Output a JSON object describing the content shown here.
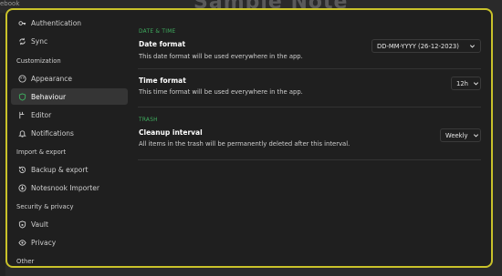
{
  "backdrop": {
    "breadcrumb": "ebook",
    "note_title": "Sample Note"
  },
  "sidebar": {
    "items": [
      {
        "label": "Authentication",
        "icon": "key-icon"
      },
      {
        "label": "Sync",
        "icon": "sync-icon"
      },
      {
        "label": "Appearance",
        "icon": "palette-icon"
      },
      {
        "label": "Behaviour",
        "icon": "shield-icon",
        "active": true
      },
      {
        "label": "Editor",
        "icon": "editor-icon"
      },
      {
        "label": "Notifications",
        "icon": "bell-icon"
      },
      {
        "label": "Backup & export",
        "icon": "backup-icon"
      },
      {
        "label": "Notesnook Importer",
        "icon": "import-icon"
      },
      {
        "label": "Vault",
        "icon": "vault-icon"
      },
      {
        "label": "Privacy",
        "icon": "eye-icon"
      }
    ],
    "sections": [
      "Customization",
      "Import & export",
      "Security & privacy",
      "Other"
    ]
  },
  "main": {
    "date_time_header": "DATE & TIME",
    "date_format": {
      "title": "Date format",
      "description": "This date format will be used everywhere in the app.",
      "value": "DD-MM-YYYY (26-12-2023)"
    },
    "time_format": {
      "title": "Time format",
      "description": "This time format will be used everywhere in the app.",
      "value": "12h"
    },
    "trash_header": "TRASH",
    "cleanup_interval": {
      "title": "Cleanup interval",
      "description": "All items in the trash will be permanently deleted after this interval.",
      "value": "Weekly"
    }
  },
  "colors": {
    "accent_border": "#c9c22a",
    "section_green": "#3fae5f",
    "active_bg": "#353535"
  }
}
